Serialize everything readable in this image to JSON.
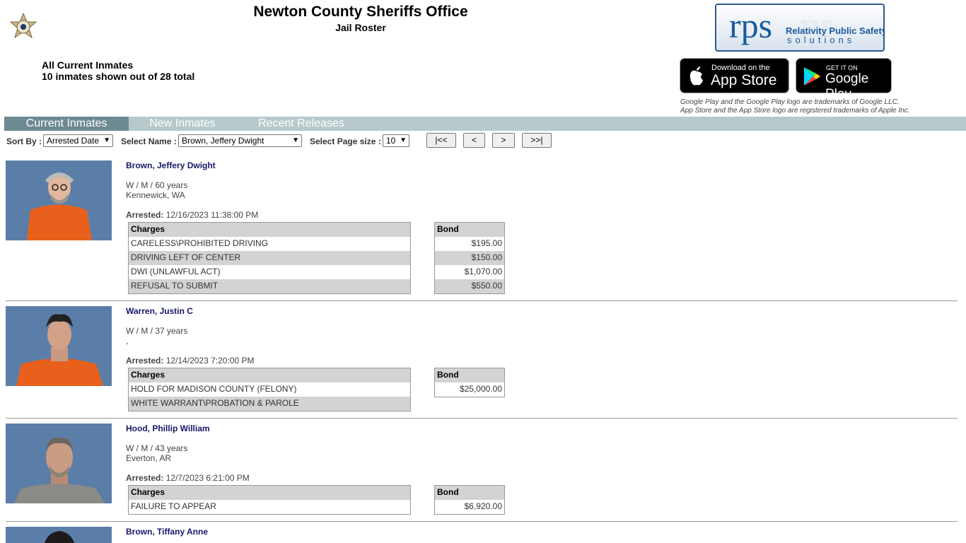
{
  "header": {
    "title": "Newton County Sheriffs Office",
    "subtitle": "Jail Roster",
    "heading_line1": "All Current Inmates",
    "heading_line2": "10 inmates shown out of 28 total",
    "logo": {
      "mark": "rps",
      "line1": "Relativity Public Safety",
      "line2": "solutions"
    },
    "app_store": {
      "small": "Download on the",
      "big": "App Store"
    },
    "google_play": {
      "small": "GET IT ON",
      "big": "Google Play"
    },
    "trademark1": "Google Play and the Google Play logo are trademarks of Google LLC.",
    "trademark2": "App Store and the App Store logo are registered trademarks of Apple Inc."
  },
  "nav": {
    "tabs": [
      {
        "label": "Current Inmates",
        "active": true
      },
      {
        "label": "New Inmates",
        "active": false
      },
      {
        "label": "Recent Releases",
        "active": false
      }
    ]
  },
  "toolbar": {
    "sort_label": "Sort By :",
    "sort_value": "Arrested Date",
    "name_label": "Select Name :",
    "name_value": "Brown, Jeffery Dwight",
    "page_size_label": "Select Page size :",
    "page_size_value": "10",
    "first_btn": "|<<",
    "prev_btn": "<",
    "next_btn": ">",
    "last_btn": ">>|"
  },
  "inmates": [
    {
      "name": "Brown, Jeffery Dwight",
      "demographics": "W / M / 60 years",
      "location": "Kennewick, WA",
      "arrested_label": "Arrested:",
      "arrested": "12/16/2023 11:38:00 PM",
      "charges_header": "Charges",
      "bond_header": "Bond",
      "charges": [
        "CARELESS\\PROHIBITED DRIVING",
        "DRIVING LEFT OF CENTER",
        "DWI (UNLAWFUL ACT)",
        "REFUSAL TO SUBMIT"
      ],
      "bonds": [
        "$195.00",
        "$150.00",
        "$1,070.00",
        "$550.00"
      ]
    },
    {
      "name": "Warren, Justin C",
      "demographics": "W / M / 37 years",
      "location": ",",
      "arrested_label": "Arrested:",
      "arrested": "12/14/2023 7:20:00 PM",
      "charges_header": "Charges",
      "bond_header": "Bond",
      "charges": [
        "HOLD FOR MADISON COUNTY (FELONY)",
        "WHITE WARRANT\\PROBATION & PAROLE"
      ],
      "bonds": [
        "$25,000.00"
      ]
    },
    {
      "name": "Hood, Phillip William",
      "demographics": "W / M / 43 years",
      "location": "Everton, AR",
      "arrested_label": "Arrested:",
      "arrested": "12/7/2023 6:21:00 PM",
      "charges_header": "Charges",
      "bond_header": "Bond",
      "charges": [
        "FAILURE TO APPEAR"
      ],
      "bonds": [
        "$6,920.00"
      ]
    },
    {
      "name": "Brown, Tiffany Anne"
    }
  ],
  "colors": {
    "nav_bar": "#b7c9cb",
    "nav_active": "#6d8a92",
    "inmate_name": "#17176a",
    "table_header": "#d3d3d3",
    "photo_background": "#5b7ea8",
    "jumpsuit": "#e8601c"
  }
}
